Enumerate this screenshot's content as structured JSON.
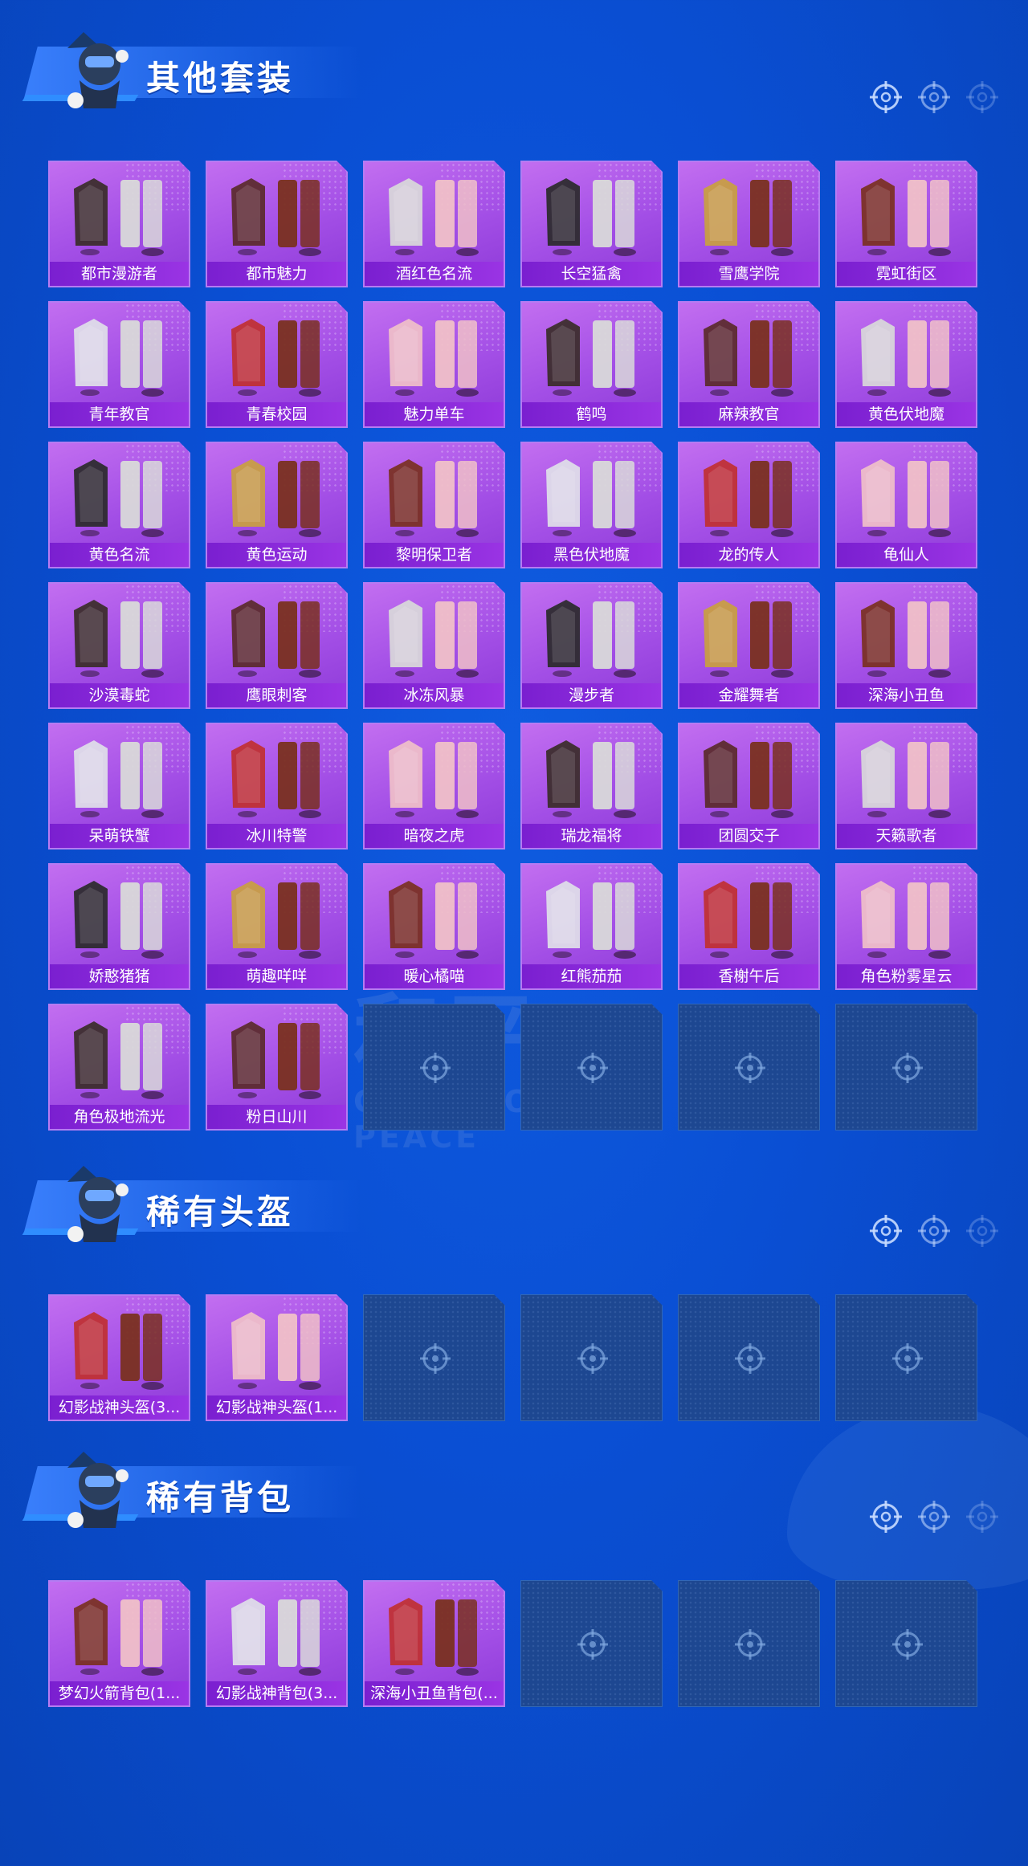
{
  "background": {
    "watermark_main": "和平",
    "watermark_sub": "GAME FOR PEACE"
  },
  "sections": [
    {
      "title": "其他套装",
      "items": [
        "都市漫游者",
        "都市魅力",
        "酒红色名流",
        "长空猛禽",
        "雪鹰学院",
        "霓虹街区",
        "青年教官",
        "青春校园",
        "魅力单车",
        "鹤鸣",
        "麻辣教官",
        "黄色伏地魔",
        "黄色名流",
        "黄色运动",
        "黎明保卫者",
        "黑色伏地魔",
        "龙的传人",
        "龟仙人",
        "沙漠毒蛇",
        "鹰眼刺客",
        "冰冻风暴",
        "漫步者",
        "金耀舞者",
        "深海小丑鱼",
        "呆萌铁蟹",
        "冰川特警",
        "暗夜之虎",
        "瑞龙福将",
        "团圆交子",
        "天籁歌者",
        "娇憨猪猪",
        "萌趣咩咩",
        "暖心橘喵",
        "红熊茄茄",
        "香榭午后",
        "角色粉雾星云",
        "角色极地流光",
        "粉日山川"
      ],
      "empty_slots": 4
    },
    {
      "title": "稀有头盔",
      "items": [
        "幻影战神头盔(3...",
        "幻影战神头盔(1..."
      ],
      "empty_slots": 4
    },
    {
      "title": "稀有背包",
      "items": [
        "梦幻火箭背包(1...",
        "幻影战神背包(3...",
        "深海小丑鱼背包(..."
      ],
      "empty_slots": 3
    }
  ],
  "colors": {
    "card": "#a34fe6",
    "label_bar": "#7a1fd0",
    "empty": "#1d4791",
    "bg": "#0a4fd4"
  },
  "icons": {
    "slot_placeholder": "crosshair-icon",
    "header_indicator": "crosshair-icon",
    "mascot": "mascot-icon"
  }
}
